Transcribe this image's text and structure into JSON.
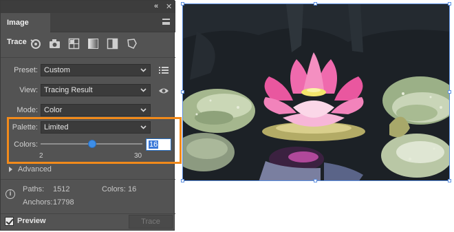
{
  "panel": {
    "title": "Image Trace",
    "collapse_glyph": "«",
    "close_glyph": "✕",
    "preset_icons": [
      "auto-color-icon",
      "high-color-photo-icon",
      "low-color-icon",
      "grayscale-icon",
      "black-and-white-icon",
      "outline-icon"
    ]
  },
  "form": {
    "preset_label": "Preset:",
    "preset_value": "Custom",
    "view_label": "View:",
    "view_value": "Tracing Result",
    "mode_label": "Mode:",
    "mode_value": "Color",
    "palette_label": "Palette:",
    "palette_value": "Limited",
    "colors_label": "Colors:",
    "colors_min": "2",
    "colors_max": "30",
    "colors_value": "16",
    "colors_slider_fraction": 0.5
  },
  "advanced_label": "Advanced",
  "stats": {
    "paths_label": "Paths:",
    "paths_value": "1512",
    "colors_label": "Colors:",
    "colors_value": "16",
    "anchors_label": "Anchors:",
    "anchors_value": "17798"
  },
  "footer": {
    "preview_label": "Preview",
    "preview_checked": true,
    "trace_label": "Trace"
  },
  "colors": {
    "accent": "#3d8ee8",
    "highlight": "#f28a1a",
    "panel_bg": "#535353",
    "selection": "#5b8ee0"
  }
}
